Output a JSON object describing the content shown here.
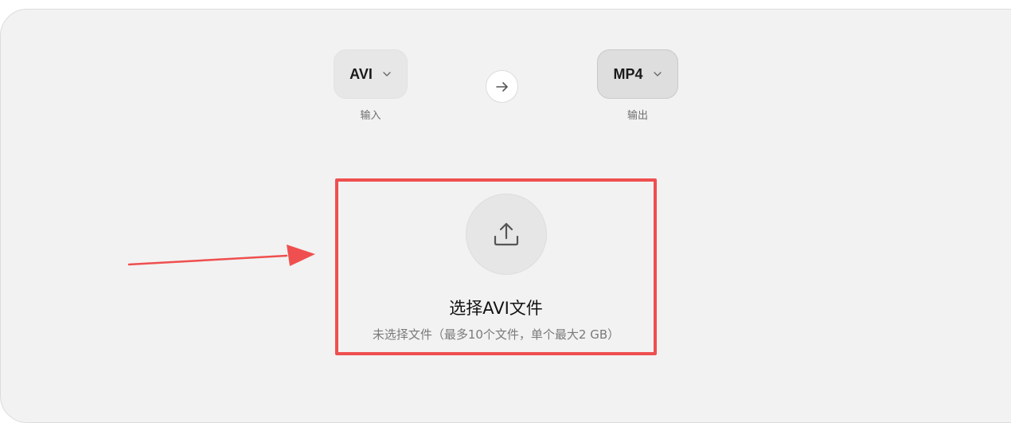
{
  "converter": {
    "input_format": "AVI",
    "input_caption": "输入",
    "output_format": "MP4",
    "output_caption": "输出"
  },
  "dropzone": {
    "title": "选择AVI文件",
    "subtitle": "未选择文件（最多10个文件，单个最大2 GB）"
  },
  "colors": {
    "annotation": "#ef4f4f",
    "panel_bg": "#f2f2f2"
  },
  "icons": {
    "dropdown": "chevron-down-icon",
    "convert": "arrow-right-icon",
    "upload": "upload-icon"
  }
}
